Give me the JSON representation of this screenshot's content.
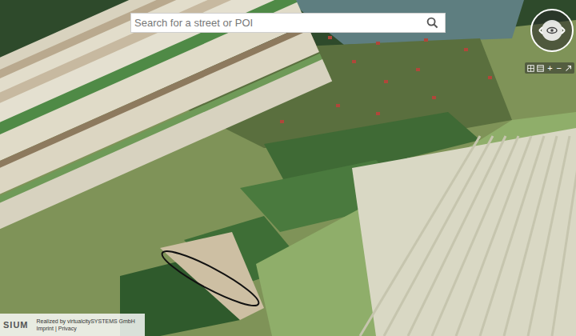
{
  "search": {
    "placeholder": "Search for a street or POI"
  },
  "toolbar": {
    "zoom_in": "+",
    "zoom_out": "−"
  },
  "attribution": {
    "logo": "SIUM",
    "credit": "Realized by virtualcitySYSTEMS GmbH",
    "links": [
      "Imprint",
      "Privacy"
    ],
    "separator": "|"
  }
}
